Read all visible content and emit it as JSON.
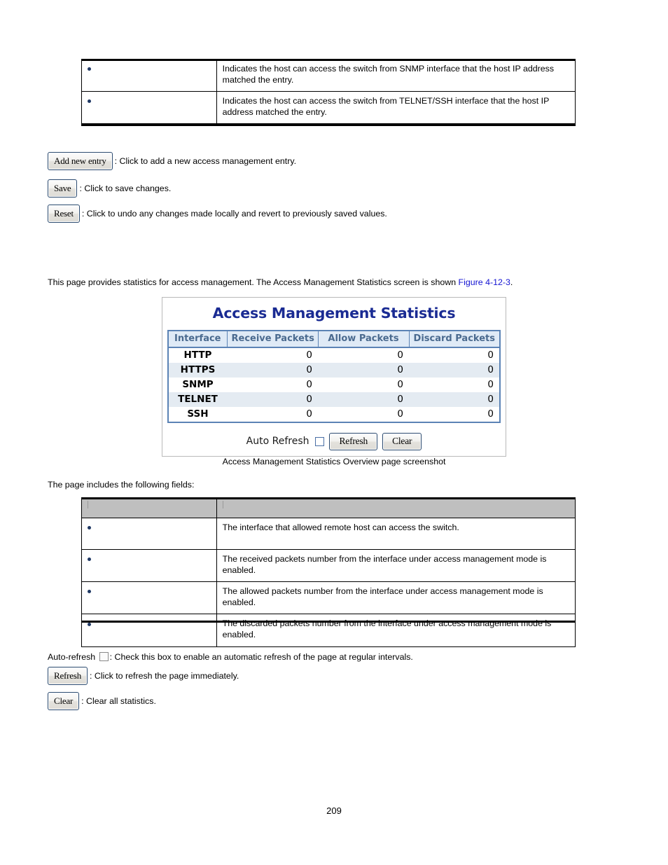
{
  "top_table": {
    "rows": [
      {
        "bullet": "•",
        "description": "Indicates the host can access the switch from SNMP interface that the host IP address matched the entry."
      },
      {
        "bullet": "•",
        "description": "Indicates the host can access the switch from TELNET/SSH interface that the host IP address matched the entry."
      }
    ]
  },
  "button_help_top": [
    {
      "label": "Add new entry",
      "text": ": Click to add a new access management entry."
    },
    {
      "label": "Save",
      "text": ": Click to save changes."
    },
    {
      "label": "Reset",
      "text": ": Click to undo any changes made locally and revert to previously saved values."
    }
  ],
  "intro": {
    "before_link": "This page provides statistics for access management. The Access Management Statistics screen is shown ",
    "link": "Figure 4-12-3",
    "after_link": "."
  },
  "screenshot": {
    "title": "Access Management Statistics",
    "table": {
      "headers": [
        "Interface",
        "Receive Packets",
        "Allow Packets",
        "Discard Packets"
      ],
      "rows": [
        {
          "interface": "HTTP",
          "receive": "0",
          "allow": "0",
          "discard": "0"
        },
        {
          "interface": "HTTPS",
          "receive": "0",
          "allow": "0",
          "discard": "0"
        },
        {
          "interface": "SNMP",
          "receive": "0",
          "allow": "0",
          "discard": "0"
        },
        {
          "interface": "TELNET",
          "receive": "0",
          "allow": "0",
          "discard": "0"
        },
        {
          "interface": "SSH",
          "receive": "0",
          "allow": "0",
          "discard": "0"
        }
      ]
    },
    "controls": {
      "auto_refresh_label": "Auto Refresh",
      "auto_refresh_checked": false,
      "refresh_label": "Refresh",
      "clear_label": "Clear"
    },
    "title_color": "#1a2b93",
    "table_border_color": "#5b83b5",
    "header_bg_color": "#dfeaf6",
    "alt_row_color": "#e4ebf2"
  },
  "caption": "Access Management Statistics Overview page screenshot",
  "fields_intro": "The page includes the following fields:",
  "fields_table": {
    "headers": [
      "",
      ""
    ],
    "rows": [
      {
        "bullet": "•",
        "description": "The interface that allowed remote host can access the switch."
      },
      {
        "bullet": "•",
        "description": "The received packets number from the interface under access management mode is enabled."
      },
      {
        "bullet": "•",
        "description": "The allowed packets number from the interface under access management mode is enabled."
      },
      {
        "bullet": "•",
        "description": "The discarded packets number from the interface under access management mode is enabled."
      }
    ]
  },
  "button_help_bottom": {
    "auto_refresh_prefix": "Auto-refresh",
    "auto_refresh_text": ": Check this box to enable an automatic refresh of the page at regular intervals.",
    "buttons": [
      {
        "label": "Refresh",
        "text": ": Click to refresh the page immediately."
      },
      {
        "label": "Clear",
        "text": ": Clear all statistics."
      }
    ]
  },
  "page_number": "209"
}
